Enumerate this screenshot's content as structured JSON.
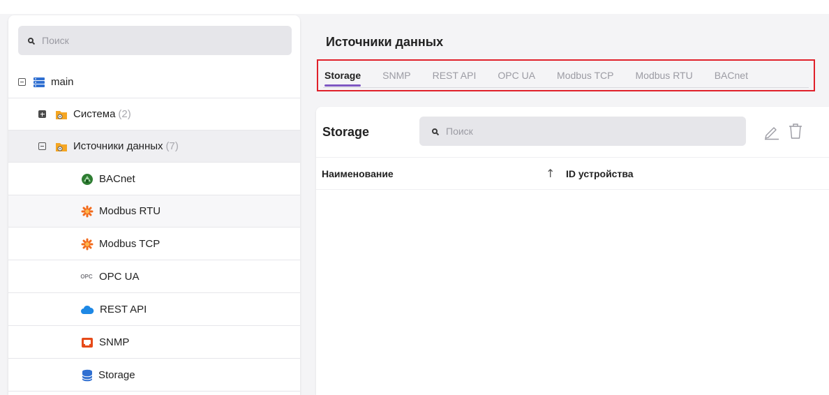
{
  "sidebar": {
    "search": {
      "placeholder": "Поиск",
      "value": ""
    },
    "tree": {
      "root": {
        "label": "main",
        "icon": "database-server-icon"
      },
      "system": {
        "label": "Система",
        "count": "(2)",
        "icon": "folder-gear-icon"
      },
      "sources": {
        "label": "Источники данных",
        "count": "(7)",
        "icon": "folder-gear-icon"
      },
      "items": [
        {
          "label": "BACnet",
          "icon": "bacnet-icon"
        },
        {
          "label": "Modbus RTU",
          "icon": "modbus-icon"
        },
        {
          "label": "Modbus TCP",
          "icon": "modbus-icon"
        },
        {
          "label": "OPC UA",
          "icon": "opc-icon",
          "icon_text": "OPC"
        },
        {
          "label": "REST API",
          "icon": "cloud-icon"
        },
        {
          "label": "SNMP",
          "icon": "snmp-icon"
        },
        {
          "label": "Storage",
          "icon": "storage-icon"
        }
      ]
    }
  },
  "main": {
    "title": "Источники данных",
    "tabs": [
      {
        "label": "Storage",
        "active": true
      },
      {
        "label": "SNMP",
        "active": false
      },
      {
        "label": "REST API",
        "active": false
      },
      {
        "label": "OPC UA",
        "active": false
      },
      {
        "label": "Modbus TCP",
        "active": false
      },
      {
        "label": "Modbus RTU",
        "active": false
      },
      {
        "label": "BACnet",
        "active": false
      }
    ],
    "card": {
      "title": "Storage",
      "search": {
        "placeholder": "Поиск",
        "value": ""
      },
      "actions": {
        "edit_icon": "pencil-icon",
        "delete_icon": "trash-icon"
      },
      "columns": [
        {
          "label": "Наименование",
          "sorted": "asc"
        },
        {
          "label": "ID устройства"
        }
      ],
      "sort_arrow": "↑",
      "rows": []
    }
  },
  "colors": {
    "accent": "#7e57c2",
    "highlight_border": "#e0202a",
    "folder": "#f5a623",
    "modbus": "#f26b1d",
    "cloud": "#1e88e5",
    "storage": "#2f6fd1"
  }
}
